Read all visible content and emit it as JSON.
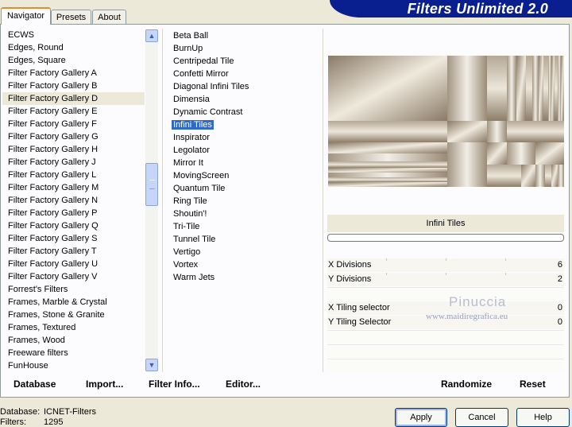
{
  "window": {
    "title": "Filters Unlimited 2.0"
  },
  "tabs": [
    {
      "label": "Navigator"
    },
    {
      "label": "Presets"
    },
    {
      "label": "About"
    }
  ],
  "categories": [
    "ECWS",
    "Edges, Round",
    "Edges, Square",
    "Filter Factory Gallery A",
    "Filter Factory Gallery B",
    "Filter Factory Gallery D",
    "Filter Factory Gallery E",
    "Filter Factory Gallery F",
    "Filter Factory Gallery G",
    "Filter Factory Gallery H",
    "Filter Factory Gallery J",
    "Filter Factory Gallery L",
    "Filter Factory Gallery M",
    "Filter Factory Gallery N",
    "Filter Factory Gallery P",
    "Filter Factory Gallery Q",
    "Filter Factory Gallery S",
    "Filter Factory Gallery T",
    "Filter Factory Gallery U",
    "Filter Factory Gallery V",
    "Forrest's Filters",
    "Frames, Marble & Crystal",
    "Frames, Stone & Granite",
    "Frames, Textured",
    "Frames, Wood",
    "Freeware filters",
    "FunHouse"
  ],
  "selected_category": "Filter Factory Gallery D",
  "filters": [
    "Beta Ball",
    "BurnUp",
    "Centripedal Tile",
    "Confetti Mirror",
    "Diagonal Infini Tiles",
    "Dimensia",
    "Dynamic Contrast",
    "Infini Tiles",
    "Inspirator",
    "Legolator",
    "Mirror It",
    "MovingScreen",
    "Quantum Tile",
    "Ring Tile",
    "Shoutin'!",
    "Tri-Tile",
    "Tunnel Tile",
    "Vertigo",
    "Vortex",
    "Warm Jets"
  ],
  "selected_filter": "Infini Tiles",
  "preview": {
    "filter_name": "Infini Tiles"
  },
  "params": [
    {
      "label": "X Divisions",
      "value": "6"
    },
    {
      "label": "Y Divisions",
      "value": "2"
    },
    {
      "label": "X Tiling selector",
      "value": "0"
    },
    {
      "label": "Y Tiling Selector",
      "value": "0"
    }
  ],
  "watermark": {
    "name": "Pinuccia",
    "url": "www.maidiregrafica.eu"
  },
  "bottom_links": {
    "database": "Database",
    "import": "Import...",
    "filter_info": "Filter Info...",
    "editor": "Editor...",
    "randomize": "Randomize",
    "reset": "Reset"
  },
  "status": {
    "database_label": "Database:",
    "database_value": "ICNET-Filters",
    "filters_label": "Filters:",
    "filters_value": "1295"
  },
  "buttons": {
    "apply": "Apply",
    "cancel": "Cancel",
    "help": "Help"
  },
  "colors": {
    "banner": "#0a1f8f",
    "selection": "#316ac5",
    "tab_highlight": "#e68b2c"
  }
}
